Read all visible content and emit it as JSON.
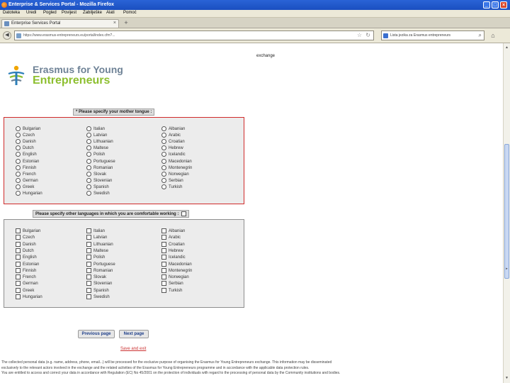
{
  "window": {
    "title": "Enterprise & Services Portal - Mozilla Firefox",
    "controls": [
      "_",
      "□",
      "×"
    ]
  },
  "menu": [
    "Datoteka",
    "Uredi",
    "Pogled",
    "Povijest",
    "Zabilješke",
    "Alati",
    "Pomoć"
  ],
  "tab": {
    "label": "Enterprise Services Portal",
    "close": "×",
    "new_tab": "+"
  },
  "nav": {
    "back": "◀",
    "url": "https://www.erasmus-entrepreneurs.eu/portal/index.cfm?...",
    "search_query": "Lista jezika za Erasmus entrepreneurs",
    "search_icon": "magnifier-icon",
    "home_icon": "home-icon"
  },
  "page": {
    "top_text": "exchange",
    "logo": {
      "line1": "Erasmus for Young",
      "line2": "Entrepreneurs",
      "colors": {
        "line1": "#6e8296",
        "line2": "#8dbf2f"
      }
    },
    "mother_tongue": {
      "title": "* Please specify your mother tongue :",
      "columns": [
        [
          "Bulgarian",
          "Czech",
          "Danish",
          "Dutch",
          "English",
          "Estonian",
          "Finnish",
          "French",
          "German",
          "Greek",
          "Hungarian"
        ],
        [
          "Italian",
          "Latvian",
          "Lithuanian",
          "Maltese",
          "Polish",
          "Portuguese",
          "Romanian",
          "Slovak",
          "Slovenian",
          "Spanish",
          "Swedish"
        ],
        [
          "Albanian",
          "Arabic",
          "Croatian",
          "Hebrew",
          "Icelandic",
          "Macedonian",
          "Montenegrin",
          "Norwegian",
          "Serbian",
          "Turkish"
        ]
      ]
    },
    "other_languages": {
      "title": "Please specify other languages in which you are comfortable working :",
      "columns": [
        [
          "Bulgarian",
          "Czech",
          "Danish",
          "Dutch",
          "English",
          "Estonian",
          "Finnish",
          "French",
          "German",
          "Greek",
          "Hungarian"
        ],
        [
          "Italian",
          "Latvian",
          "Lithuanian",
          "Maltese",
          "Polish",
          "Portuguese",
          "Romanian",
          "Slovak",
          "Slovenian",
          "Spanish",
          "Swedish"
        ],
        [
          "Albanian",
          "Arabic",
          "Croatian",
          "Hebrew",
          "Icelandic",
          "Macedonian",
          "Montenegrin",
          "Norwegian",
          "Serbian",
          "Turkish"
        ]
      ]
    },
    "buttons": {
      "previous": "Previous page",
      "next": "Next page"
    },
    "save_link": "Save and exit",
    "footer": [
      "The collected personal data (e.g. name, address, phone, email...) will be processed for the exclusive purpose of organising the Erasmus for Young Entrepreneurs exchange. This information may be disseminated",
      "exclusively to the relevant actors involved in the exchange and the related activities of the Erasmus for Young Entrepreneurs programme and in accordance with the applicable data protection rules.",
      "You are entitled to access and correct your data in accordance with Regulation (EC) No 45/2001 on the protection of individuals with regard to the processing of personal data by the Community institutions and bodies."
    ]
  }
}
